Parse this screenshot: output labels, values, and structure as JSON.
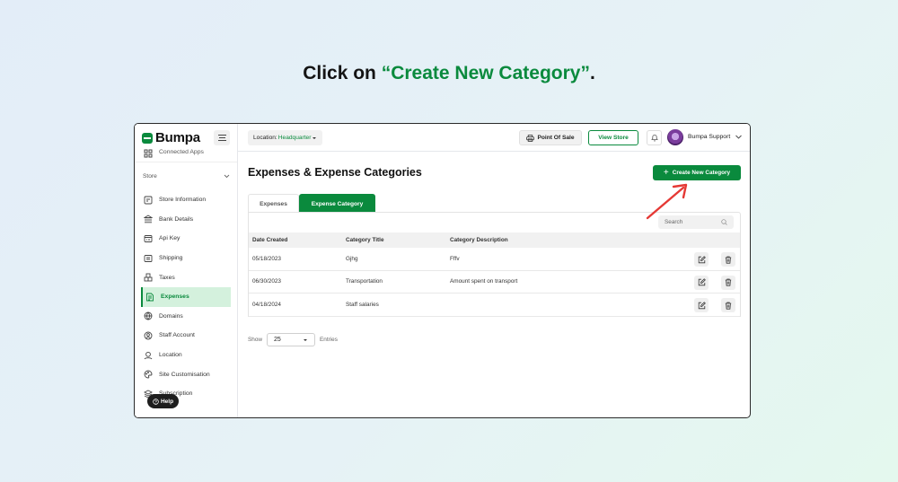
{
  "instruction": {
    "prefix": "Click on ",
    "highlight": "“Create New Category”",
    "suffix": "."
  },
  "brand": {
    "name": "Bumpa"
  },
  "sidebar": {
    "cut_item": "Connected Apps",
    "section": "Store",
    "items": [
      {
        "label": "Store Information",
        "icon": "store-info-icon"
      },
      {
        "label": "Bank Details",
        "icon": "bank-icon"
      },
      {
        "label": "Api Key",
        "icon": "api-key-icon"
      },
      {
        "label": "Shipping",
        "icon": "shipping-icon"
      },
      {
        "label": "Taxes",
        "icon": "taxes-icon"
      },
      {
        "label": "Expenses",
        "icon": "expenses-icon",
        "active": true
      },
      {
        "label": "Domains",
        "icon": "globe-icon"
      },
      {
        "label": "Staff Account",
        "icon": "user-icon"
      },
      {
        "label": "Location",
        "icon": "location-icon"
      },
      {
        "label": "Site Customisation",
        "icon": "palette-icon"
      },
      {
        "label": "Subscription",
        "icon": "layers-icon"
      }
    ],
    "help_label": "Help"
  },
  "topbar": {
    "location_label": "Location:",
    "location_value": "Headquarter",
    "pos_label": "Point Of Sale",
    "view_store_label": "View Store",
    "user_name": "Bumpa Support"
  },
  "main": {
    "title": "Expenses & Expense Categories",
    "create_label": "Create New Category",
    "tabs": [
      {
        "label": "Expenses",
        "active": false
      },
      {
        "label": "Expense Category",
        "active": true
      }
    ],
    "search_placeholder": "Search",
    "columns": [
      "Date Created",
      "Category Title",
      "Category Description"
    ],
    "rows": [
      [
        "05/18/2023",
        "Gjhg",
        "Fffv"
      ],
      [
        "06/30/2023",
        "Transportation",
        "Amount spent on transport"
      ],
      [
        "04/18/2024",
        "Staff salaries",
        ""
      ]
    ],
    "pager": {
      "show_label": "Show",
      "page_size": "25",
      "entries_label": "Entries"
    }
  },
  "colors": {
    "accent": "#0a8a3d",
    "annotation_arrow": "#e53935",
    "active_bg": "#d4f1dd"
  }
}
